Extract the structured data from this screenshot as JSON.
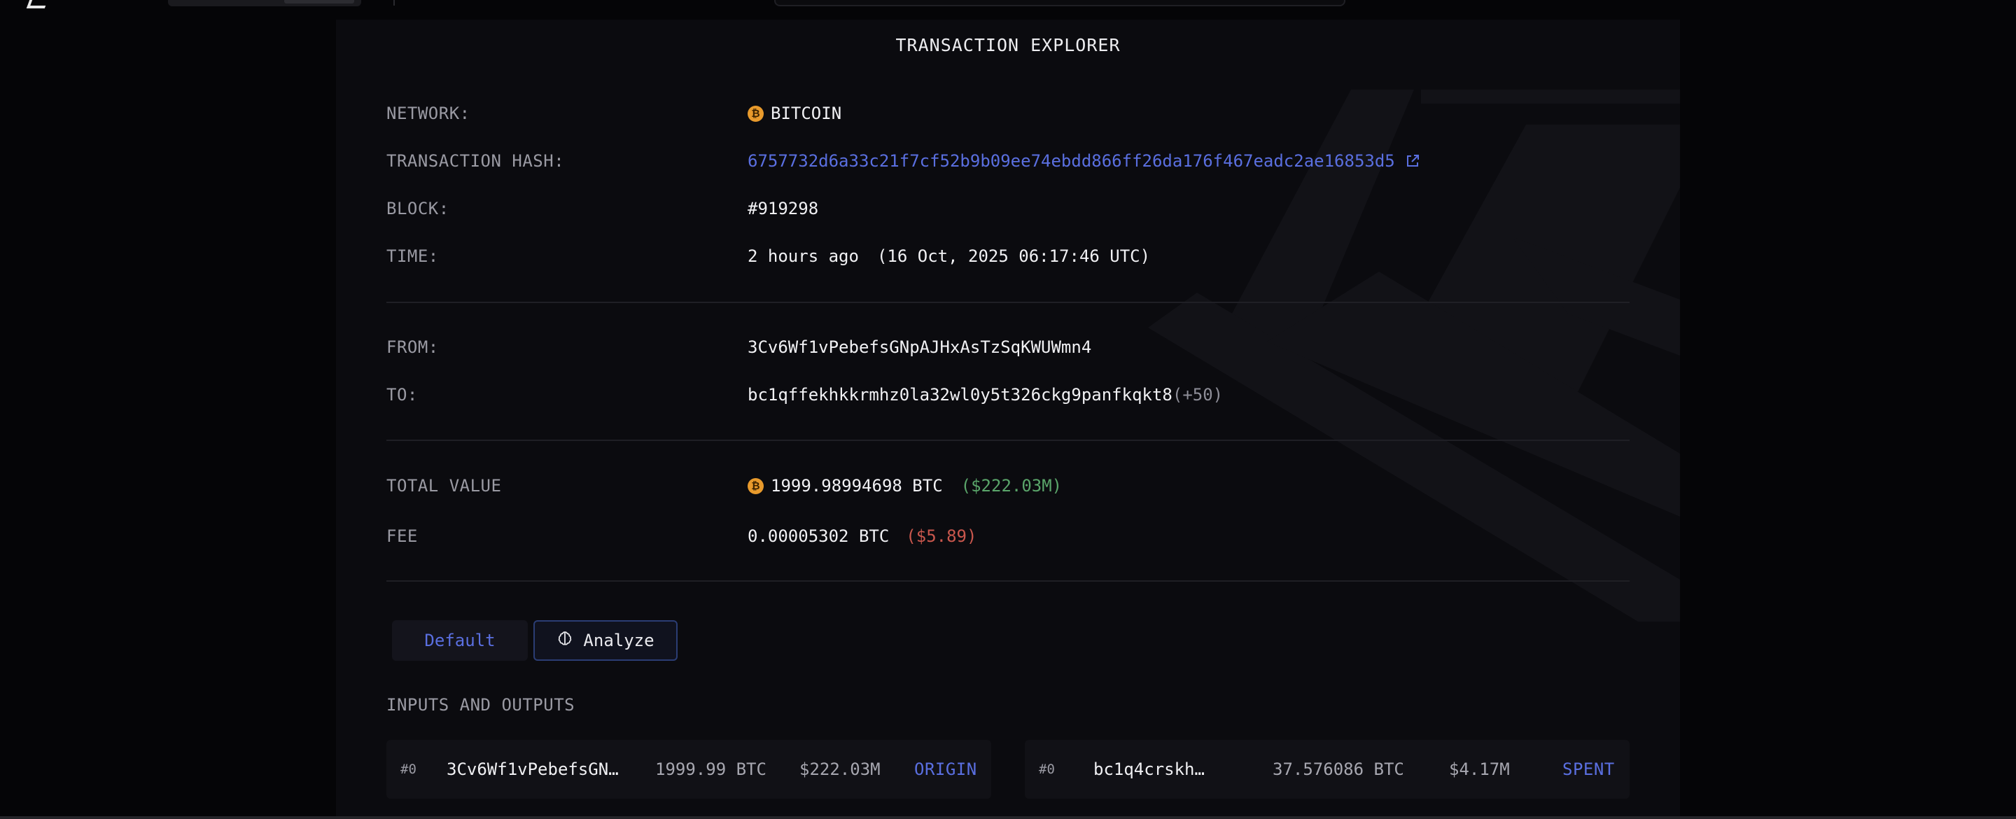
{
  "top": {
    "logo_icon": "logo-chevron-icon",
    "search_icon": "search-bar"
  },
  "title": "TRANSACTION EXPLORER",
  "details": {
    "network_label": "NETWORK:",
    "network_value": "BITCOIN",
    "network_icon": "bitcoin-icon",
    "coin_glyph": "₿",
    "hash_label": "TRANSACTION HASH:",
    "hash_value": "6757732d6a33c21f7cf52b9b09ee74ebdd866ff26da176f467eadc2ae16853d5",
    "hash_link_icon": "external-link-icon",
    "block_label": "BLOCK:",
    "block_value": "#919298",
    "time_label": "TIME:",
    "time_relative": "2 hours ago",
    "time_absolute": "(16 Oct, 2025 06:17:46 UTC)",
    "from_label": "FROM:",
    "from_value": "3Cv6Wf1vPebefsGNpAJHxAsTzSqKWUWmn4",
    "to_label": "TO:",
    "to_value": "bc1qffekhkkrmhz0la32wl0y5t326ckg9panfkqkt8",
    "to_extra": "(+50)",
    "total_label": "TOTAL VALUE",
    "total_btc": "1999.98994698 BTC",
    "total_usd": "($222.03M)",
    "fee_label": "FEE",
    "fee_btc": "0.00005302 BTC",
    "fee_usd": "($5.89)"
  },
  "tabs": {
    "default_label": "Default",
    "analyze_label": "Analyze",
    "analyze_icon": "brain-icon"
  },
  "io": {
    "section_label": "INPUTS AND OUTPUTS",
    "inputs": [
      {
        "index": "#0",
        "address": "3Cv6Wf1vPebefsGN…",
        "amount": "1999.99 BTC",
        "usd": "$222.03M",
        "status": "ORIGIN"
      }
    ],
    "outputs": [
      {
        "index": "#0",
        "address": "bc1q4crskh…",
        "amount": "37.576086 BTC",
        "usd": "$4.17M",
        "status": "SPENT"
      }
    ]
  },
  "colors": {
    "accent": "#5a6fe0",
    "positive": "#5aa56a",
    "negative": "#c9574d",
    "bitcoin": "#e89a2c"
  }
}
